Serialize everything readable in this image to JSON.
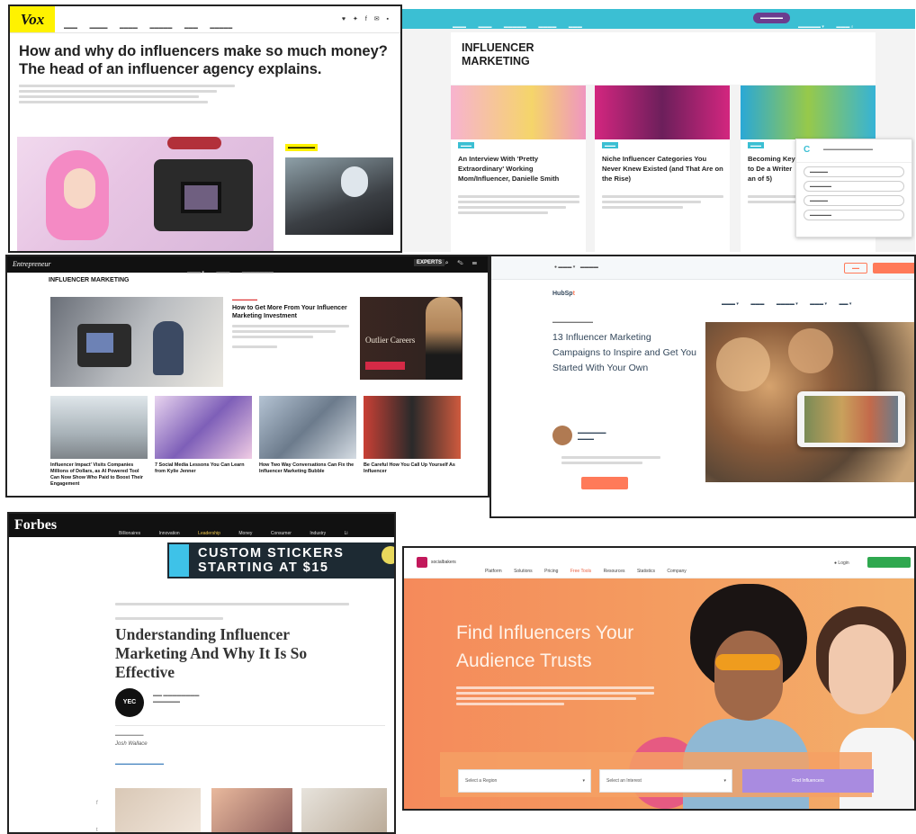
{
  "vox": {
    "logo": "Vox",
    "nav": [
      "",
      "",
      "",
      "",
      "",
      ""
    ],
    "headline": "How and why do influencers make so much money? The head of an influencer agency explains.",
    "side_tag": ""
  },
  "blog": {
    "title": "INFLUENCER MARKETING",
    "cards": [
      {
        "title": "An Interview With 'Pretty Extraordinary' Working Mom/Influencer, Danielle Smith"
      },
      {
        "title": "Niche Influencer Categories You Never Knew Existed (and That Are on the Rise)"
      },
      {
        "title": "Becoming Keys to De a Writer an of 5)"
      }
    ]
  },
  "entrepreneur": {
    "brand": "Entrepreneur",
    "experts": "EXPERTS",
    "section": "INFLUENCER MARKETING",
    "feature_title": "How to Get More From Your Influencer Marketing Investment",
    "ad_text": "Outlier Careers",
    "thumbs": [
      {
        "caption": "Influencer Impact' Visits Companies Millions of Dollars, as AI Powered Tool Can Now Show Who Paid to Boost Their Engagement"
      },
      {
        "caption": "7 Social Media Lessons You Can Learn from Kylie Jenner"
      },
      {
        "caption": "How Two Way Conversations Can Fix the Influencer Marketing Bubble"
      },
      {
        "caption": "Be Careful How You Call Up Yourself As Influencer"
      }
    ]
  },
  "hubspot": {
    "logo_prefix": "HubSp",
    "logo_suffix": "t",
    "title": "13 Influencer Marketing Campaigns to Inspire and Get You Started With Your Own"
  },
  "forbes": {
    "brand": "Forbes",
    "nav": [
      "Billionaires",
      "Innovation",
      "Leadership",
      "Money",
      "Consumer",
      "Industry",
      "Li"
    ],
    "ad_text": "CUSTOM STICKERS STARTING AT $15",
    "title": "Understanding Influencer Marketing And Why It Is So Effective",
    "avatar": "YEC",
    "editor": "Josh Wallace"
  },
  "socialbakers": {
    "logo": "socialbakers",
    "nav": [
      "Platform",
      "Solutions",
      "Pricing",
      "Free Tools",
      "Resources",
      "Statistics",
      "Company"
    ],
    "login": "Login",
    "headline": "Find Influencers Your Audience Trusts",
    "select1": "Select a Region",
    "select2": "Select an Interest",
    "find_button": "Find Influencers"
  }
}
